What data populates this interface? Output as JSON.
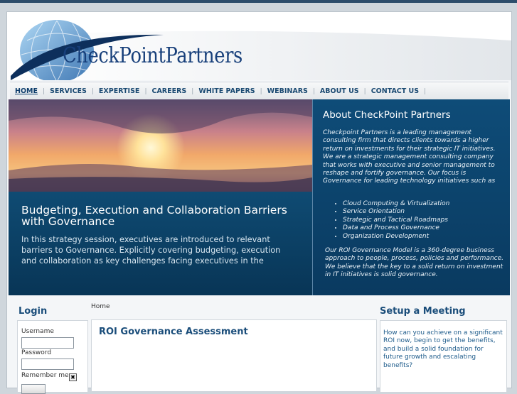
{
  "logo": {
    "text": "CheckPointPartners"
  },
  "nav": {
    "items": [
      "HOME",
      "SERVICES",
      "EXPERTISE",
      "CAREERS",
      "WHITE PAPERS",
      "WEBINARS",
      "ABOUT US",
      "CONTACT US"
    ],
    "separator": "|"
  },
  "hero": {
    "title": "Budgeting, Execution and Collaboration Barriers with Governance",
    "body": "In this strategy session, executives are introduced to relevant barriers to Governance. Explicitly covering budgeting, execution and collaboration as key challenges facing executives in the effective"
  },
  "about": {
    "title": "About CheckPoint Partners",
    "intro": "Checkpoint Partners is a leading management consulting firm that directs clients towards a higher return on investments for their strategic IT initiatives. We are a strategic management consulting company that works with executive and senior management to reshape and fortify governance. Our focus is Governance for leading technology initiatives such as",
    "list": [
      "Cloud Computing & Virtualization",
      "Service Orientation",
      "Strategic and Tactical Roadmaps",
      "Data and Process Governance",
      "Organization Development"
    ],
    "closing": "Our ROI Governance Model is a 360-degree business approach to people, process, policies and performance. We believe that the key to a solid return on investment in IT initiatives is solid governance."
  },
  "login": {
    "title": "Login",
    "username_label": "Username",
    "password_label": "Password",
    "remember_label": "Remember me"
  },
  "breadcrumb": "Home",
  "main": {
    "title": "ROI Governance Assessment"
  },
  "meeting": {
    "title": "Setup a Meeting",
    "text": "How can you achieve on a significant ROI now, begin to get the benefits, and build a solid foundation for future growth and escalating benefits?"
  },
  "colors": {
    "brand": "#173f7a",
    "nav_text": "#1b4a72",
    "hero_bg": "#0d3a5e",
    "heading": "#1a4d7a"
  }
}
